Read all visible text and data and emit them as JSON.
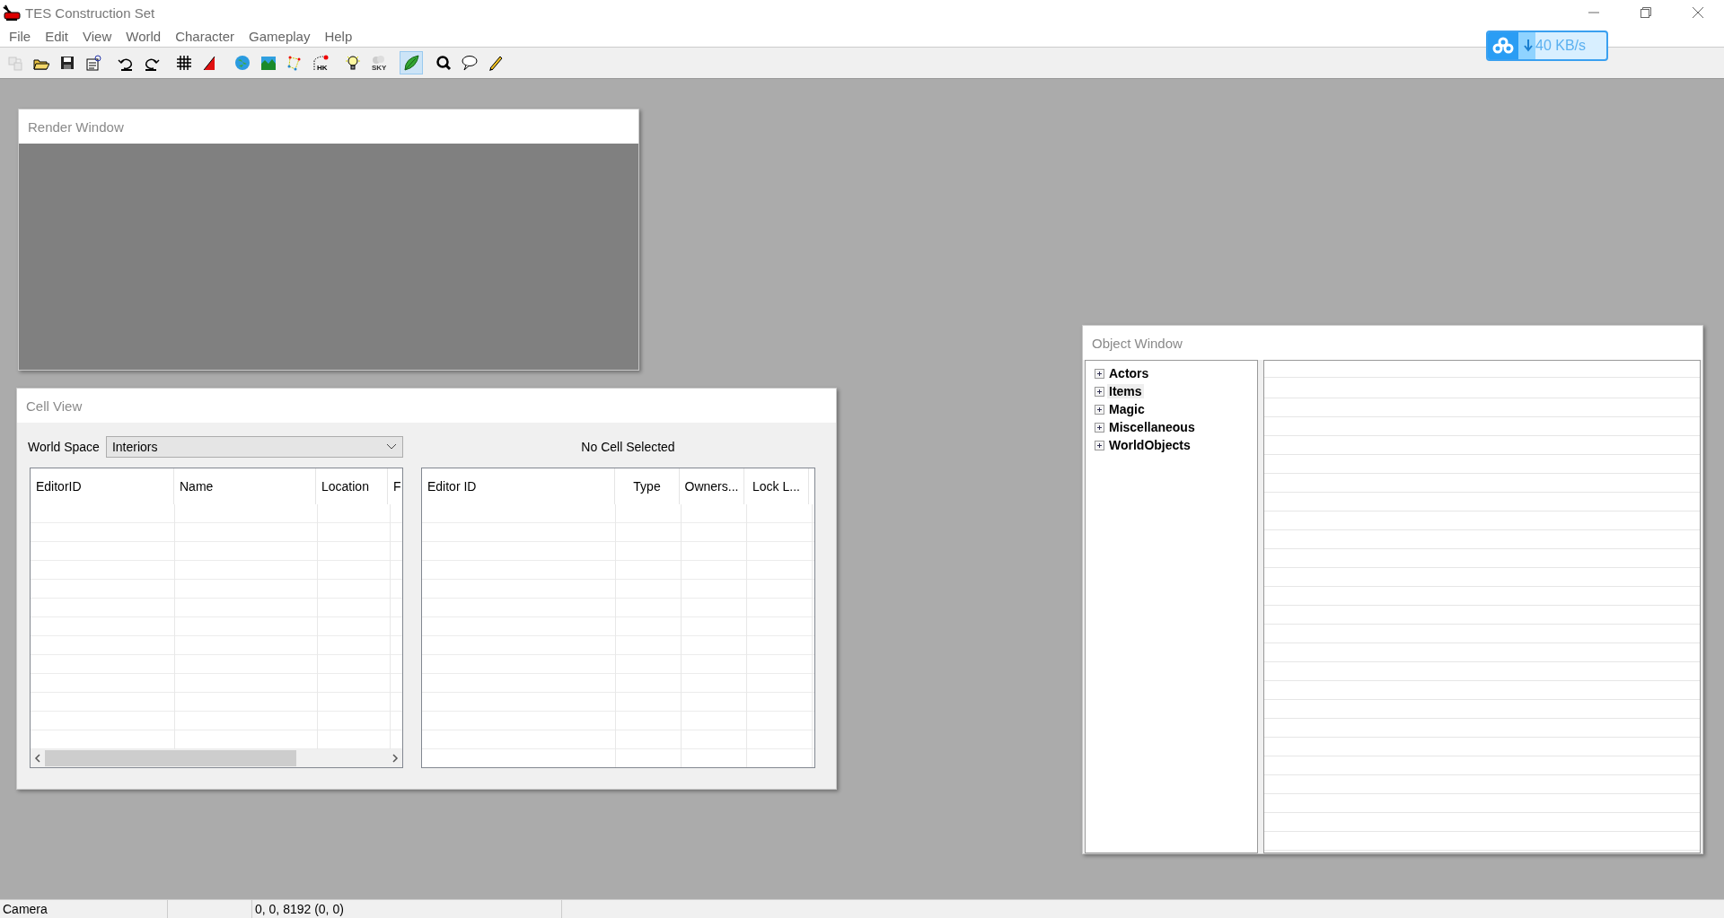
{
  "window": {
    "title": "TES Construction Set"
  },
  "menu": [
    "File",
    "Edit",
    "View",
    "World",
    "Character",
    "Gameplay",
    "Help"
  ],
  "toolbar": [
    [
      {
        "kind": "stack",
        "pressed": false,
        "disabled": true
      },
      {
        "kind": "open",
        "pressed": false,
        "disabled": false
      },
      {
        "kind": "save",
        "pressed": false,
        "disabled": false
      },
      {
        "kind": "properties",
        "pressed": false,
        "disabled": false
      }
    ],
    [
      {
        "kind": "undo",
        "pressed": false,
        "disabled": false
      },
      {
        "kind": "redo",
        "pressed": false,
        "disabled": false
      }
    ],
    [
      {
        "kind": "grid",
        "pressed": false,
        "disabled": false
      },
      {
        "kind": "angle",
        "pressed": false,
        "disabled": false
      }
    ],
    [
      {
        "kind": "globe",
        "pressed": false,
        "disabled": false
      },
      {
        "kind": "landscape",
        "pressed": false,
        "disabled": false
      },
      {
        "kind": "nodes",
        "pressed": false,
        "disabled": false
      },
      {
        "kind": "havok",
        "label": "HK",
        "pressed": false,
        "disabled": false
      }
    ],
    [
      {
        "kind": "bulb",
        "pressed": false,
        "disabled": false
      },
      {
        "kind": "sky",
        "label": "SKY",
        "pressed": false,
        "disabled": false
      }
    ],
    [
      {
        "kind": "leaf",
        "pressed": true,
        "disabled": false
      }
    ],
    [
      {
        "kind": "search",
        "pressed": false,
        "disabled": false
      },
      {
        "kind": "speech",
        "pressed": false,
        "disabled": false
      },
      {
        "kind": "pencil",
        "pressed": false,
        "disabled": false
      }
    ]
  ],
  "speed_widget": {
    "reading": "40 KB/s"
  },
  "render_window": {
    "title": "Render Window"
  },
  "cell_view": {
    "title": "Cell View",
    "world_space_label": "World Space",
    "world_space": "Interiors",
    "status": "No Cell Selected",
    "cells_table": {
      "columns": [
        "EditorID",
        "Name",
        "Location",
        "F"
      ]
    },
    "objects_table": {
      "columns": [
        "Editor ID",
        "Type",
        "Owners...",
        "Lock L..."
      ]
    }
  },
  "object_window": {
    "title": "Object Window",
    "tree": [
      {
        "label": "Actors",
        "expanded": false,
        "selected": false
      },
      {
        "label": "Items",
        "expanded": false,
        "selected": true
      },
      {
        "label": "Magic",
        "expanded": false,
        "selected": false
      },
      {
        "label": "Miscellaneous",
        "expanded": false,
        "selected": false
      },
      {
        "label": "WorldObjects",
        "expanded": false,
        "selected": false
      }
    ]
  },
  "status_bar": {
    "mode": "Camera",
    "position": "0, 0, 8192 (0, 0)"
  }
}
